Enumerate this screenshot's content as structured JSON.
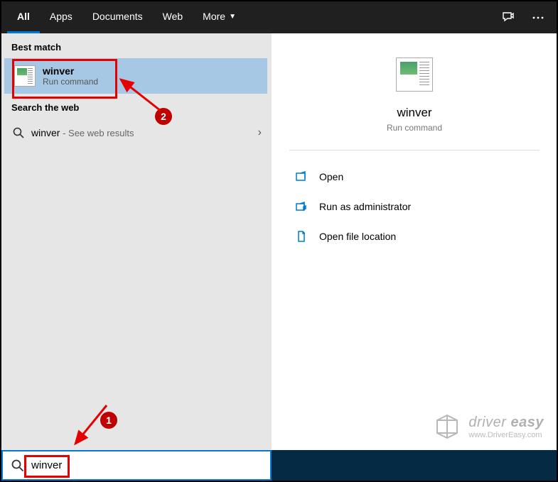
{
  "header": {
    "tabs": [
      {
        "label": "All",
        "active": true
      },
      {
        "label": "Apps",
        "active": false
      },
      {
        "label": "Documents",
        "active": false
      },
      {
        "label": "Web",
        "active": false
      },
      {
        "label": "More",
        "active": false,
        "dropdown": true
      }
    ]
  },
  "left": {
    "best_match_header": "Best match",
    "best_match": {
      "title": "winver",
      "subtitle": "Run command"
    },
    "search_web_header": "Search the web",
    "web_result": {
      "query": "winver",
      "suffix": " - See web results"
    }
  },
  "right": {
    "title": "winver",
    "subtitle": "Run command",
    "actions": {
      "open": "Open",
      "run_admin": "Run as administrator",
      "open_location": "Open file location"
    }
  },
  "search": {
    "value": "winver"
  },
  "annotations": {
    "badge1": "1",
    "badge2": "2"
  },
  "watermark": {
    "brand_a": "driver",
    "brand_b": "easy",
    "url": "www.DriverEasy.com"
  }
}
